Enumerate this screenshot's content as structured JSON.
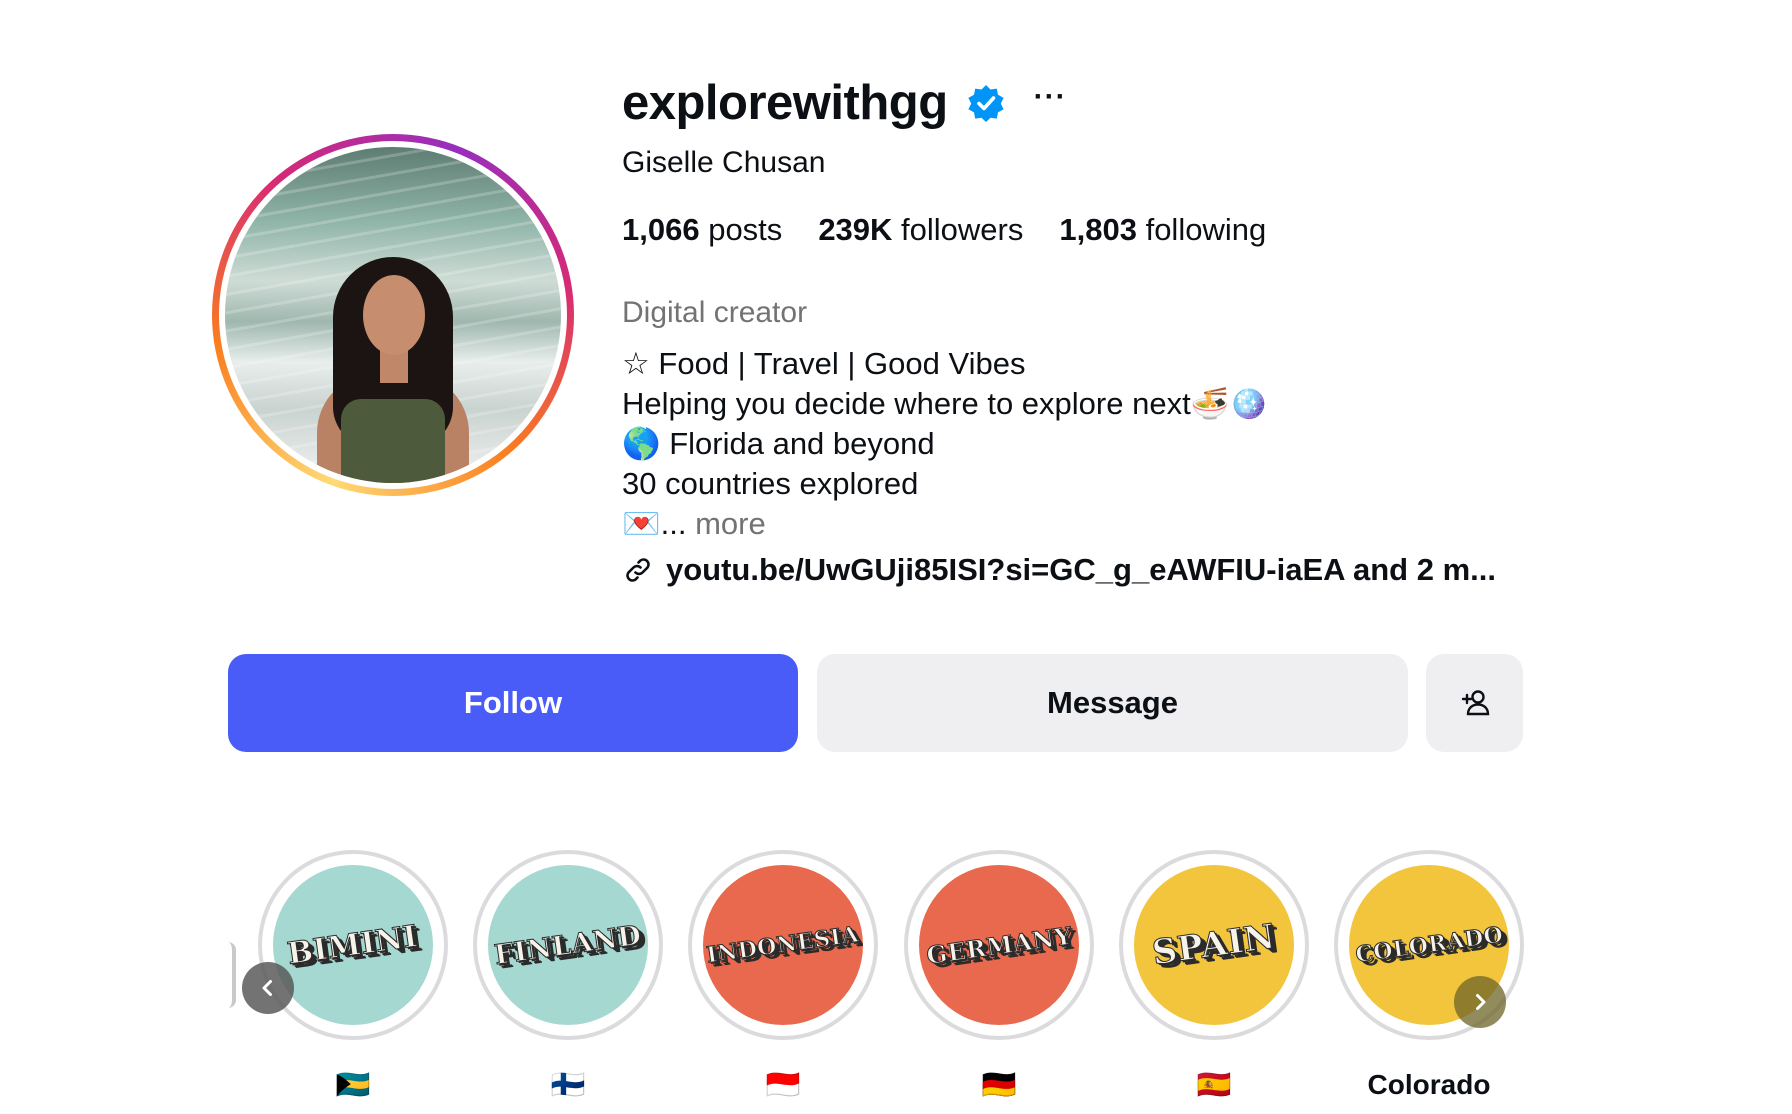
{
  "profile": {
    "username": "explorewithgg",
    "verified_icon": "verified-badge-icon",
    "more_label": "···",
    "full_name": "Giselle Chusan",
    "stats": {
      "posts_count": "1,066",
      "posts_label": "posts",
      "followers_count": "239K",
      "followers_label": "followers",
      "following_count": "1,803",
      "following_label": "following"
    },
    "category": "Digital creator",
    "bio": {
      "line1": "☆ Food | Travel | Good Vibes",
      "line2": "Helping you decide where to explore next🍜🪩",
      "line3": "🌎 Florida and beyond",
      "line4": "30 countries explored",
      "line5_prefix": "💌...",
      "more_label": "more"
    },
    "link": "youtu.be/UwGUji85ISI?si=GC_g_eAWFIU-iaEA and 2 m..."
  },
  "actions": {
    "follow_label": "Follow",
    "message_label": "Message",
    "add_user_icon": "add-user-icon"
  },
  "colors": {
    "follow_button": "#4a5cf7",
    "secondary_button": "#efeff2",
    "verified": "#0095f6",
    "muted_text": "#737373"
  },
  "highlights": [
    {
      "cover_text": "BIMINI",
      "label": "🇧🇸",
      "bg": "#a4d8d0"
    },
    {
      "cover_text": "FINLAND",
      "label": "🇫🇮",
      "bg": "#a4d8d0"
    },
    {
      "cover_text": "INDONESIA",
      "label": "🇮🇩",
      "bg": "#e8694d"
    },
    {
      "cover_text": "GERMANY",
      "label": "🇩🇪",
      "bg": "#e8694d"
    },
    {
      "cover_text": "SPAIN",
      "label": "🇪🇸",
      "bg": "#f2c53d"
    },
    {
      "cover_text": "COLORADO",
      "label": "Colorado",
      "bg": "#f2c53d"
    }
  ]
}
